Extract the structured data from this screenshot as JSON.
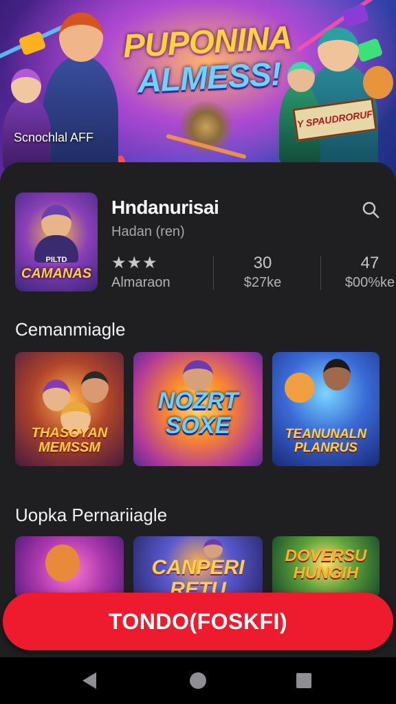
{
  "hero": {
    "title_line1": "PUPONINA",
    "title_line2": "ALMESS!",
    "caption": "Scnochlal AFF",
    "sign_text": "Y SPAUDRORUF"
  },
  "app": {
    "title": "Hndanurisai",
    "subtitle": "Hadan (ren)",
    "icon_text_small": "PILTD",
    "icon_text": "CAMANAS",
    "stars": "★★★",
    "rating_label": "Almaraon",
    "stat2_value": "30",
    "stat2_label": "$27ke",
    "stat3_value": "47",
    "stat3_label": "$00%ke"
  },
  "sections": {
    "first_title": "Cemanmiagle",
    "second_title": "Uopka Pernariiagle"
  },
  "row1": [
    {
      "label": "THASOYAN MEMSSM"
    },
    {
      "label": "NOZRT SOXE"
    },
    {
      "label": "TEANUNALN PLANRUS"
    }
  ],
  "row2": [
    {
      "label": ""
    },
    {
      "label": "CANPERI RETU"
    },
    {
      "label": "DOVERSU HUNGIH"
    }
  ],
  "cta_label": "TONDO(FOSKFI)",
  "colors": {
    "accent": "#ee1b2e",
    "background": "#1f1f21",
    "gold": "#ffd23d"
  }
}
